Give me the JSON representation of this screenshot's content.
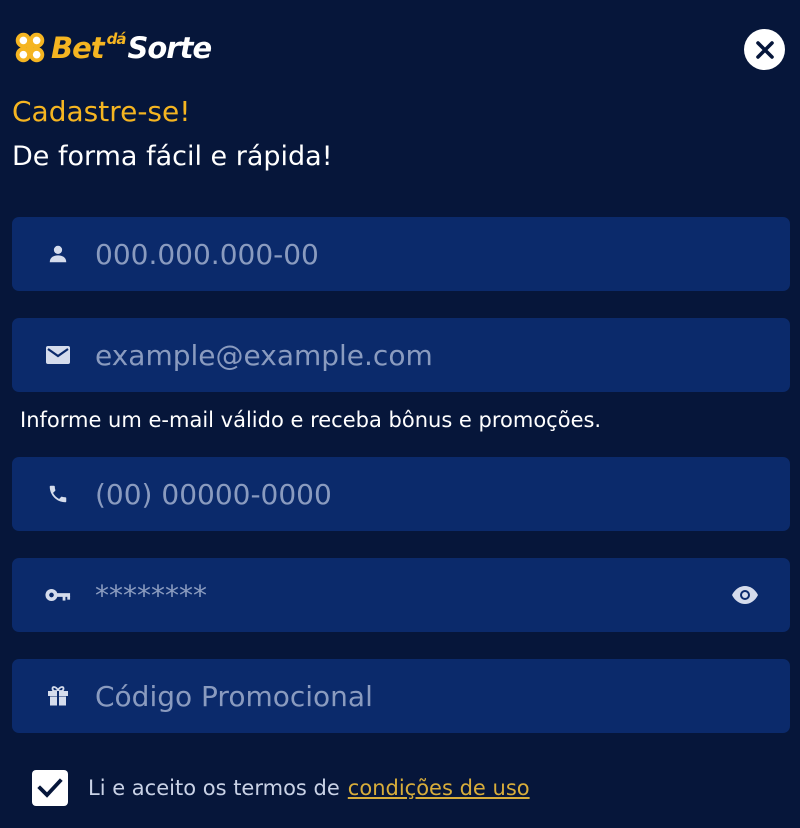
{
  "header": {
    "logo": {
      "part1": "Bet",
      "part2": "dá",
      "part3": "Sorte"
    },
    "close_icon": "close-icon"
  },
  "titles": {
    "primary": "Cadastre-se!",
    "secondary": "De forma fácil e rápida!"
  },
  "form": {
    "cpf": {
      "placeholder": "000.000.000-00",
      "icon": "person-icon"
    },
    "email": {
      "placeholder": "example@example.com",
      "icon": "mail-icon"
    },
    "email_hint": "Informe um e-mail válido e receba bônus e promoções.",
    "phone": {
      "placeholder": "(00) 00000-0000",
      "icon": "phone-icon"
    },
    "password": {
      "placeholder": "********",
      "icon": "key-icon",
      "toggle_icon": "eye-icon"
    },
    "promo": {
      "placeholder": "Código Promocional",
      "icon": "gift-icon"
    }
  },
  "terms": {
    "checked": true,
    "text": "Li e aceito os termos de",
    "link": "condições de uso"
  },
  "colors": {
    "background": "#06163a",
    "field": "#0b2a6b",
    "accent": "#f5b521",
    "placeholder": "#8a9bbf"
  }
}
